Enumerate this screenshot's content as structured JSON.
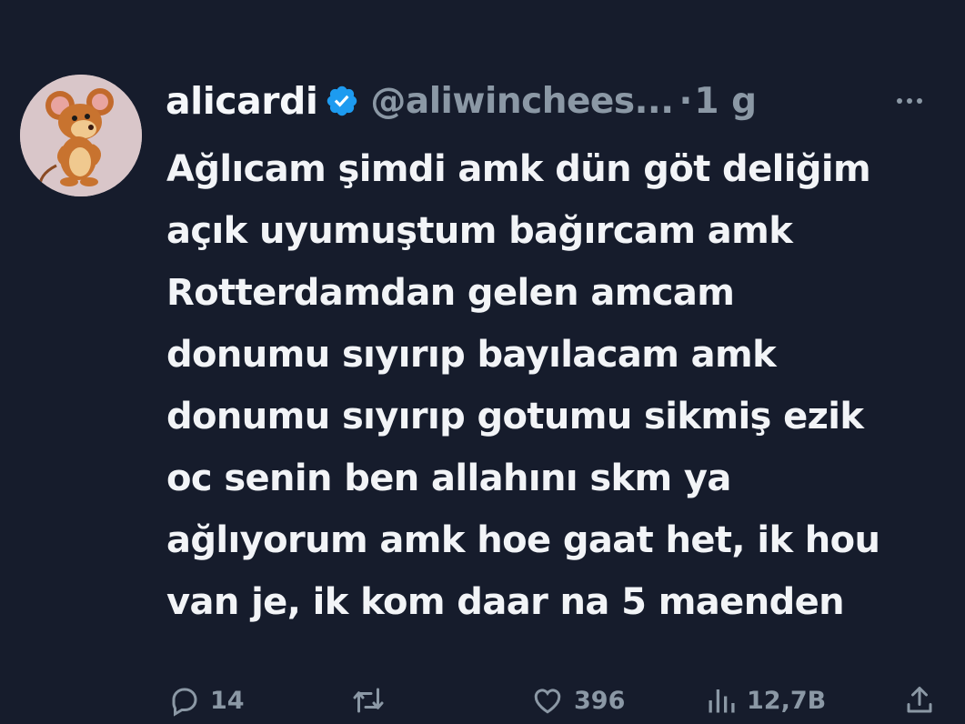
{
  "tweet": {
    "author_name": "alicardi",
    "handle": "@aliwinchees...",
    "separator": "·",
    "time": "1 g",
    "text_lines": [
      "Ağlıcam şimdi amk dün göt deliğim",
      "açık uyumuştum bağırcam amk",
      "Rotterdamdan gelen amcam",
      "donumu sıyırıp bayılacam amk",
      "donumu sıyırıp gotumu sikmiş ezik",
      "oc senin ben allahını skm ya",
      "ağlıyorum amk hoe gaat het, ik hou",
      "van je, ik kom daar na 5 maenden"
    ]
  },
  "actions": {
    "replies": "14",
    "reposts": "",
    "likes": "396",
    "views": "12,7B"
  },
  "icons": {
    "avatar": "mouse-cartoon-avatar",
    "verified": "verified-badge-icon",
    "more": "more-options-icon",
    "reply": "reply-icon",
    "repost": "repost-icon",
    "like": "like-icon",
    "views": "views-icon",
    "share": "share-icon"
  },
  "colors": {
    "background": "#161c2c",
    "text": "#f2f4f7",
    "muted": "#8b98a5",
    "verified_blue": "#1d9bf0"
  }
}
